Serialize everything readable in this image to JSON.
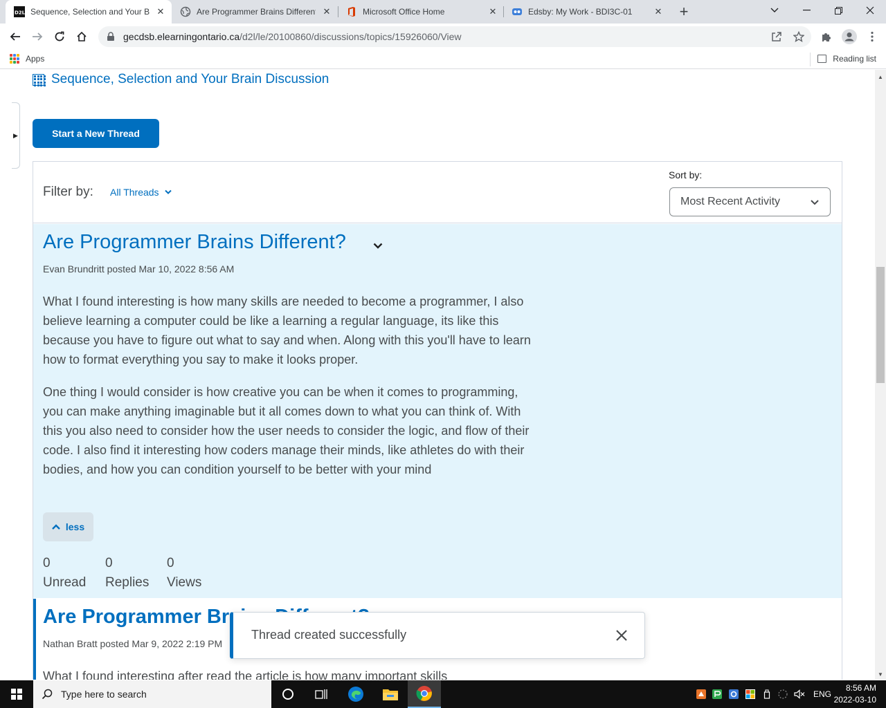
{
  "browser": {
    "tabs": [
      {
        "title": "Sequence, Selection and Your Bra",
        "active": true,
        "favicon": "d2l-logo-icon"
      },
      {
        "title": "Are Programmer Brains Different",
        "active": false,
        "favicon": "globe-icon"
      },
      {
        "title": "Microsoft Office Home",
        "active": false,
        "favicon": "office-icon"
      },
      {
        "title": "Edsby: My Work - BDI3C-01",
        "active": false,
        "favicon": "edsby-icon"
      }
    ],
    "url_host": "gecdsb.elearningontario.ca",
    "url_path": "/d2l/le/20100860/discussions/topics/15926060/View",
    "bookmarks": {
      "apps": "Apps",
      "reading_list": "Reading list"
    }
  },
  "page": {
    "breadcrumb": "Sequence, Selection and Your Brain Discussion",
    "new_thread_button": "Start a New Thread",
    "filter_label": "Filter by:",
    "filter_value": "All Threads",
    "sort_label": "Sort by:",
    "sort_value": "Most Recent Activity",
    "threads": [
      {
        "title": "Are Programmer Brains Different?",
        "author": "Evan Brundritt",
        "meta": "Evan Brundritt posted Mar 10, 2022 8:56 AM",
        "paragraphs": [
          "What I found interesting is how many skills are needed to become a programmer, I also believe learning a computer could be like a learning a regular language, its like this because you have to figure out what to say and when. Along with this you'll have to learn how to format everything you say to make it looks proper.",
          "One thing I would consider is how creative you can be when it comes to programming, you can make anything imaginable but it all comes down to what you can think of. With this you also need to consider how the user needs to consider the logic, and flow of their code. I also find it interesting how coders manage their minds, like athletes do with their bodies, and how you can condition yourself to be better with your mind"
        ],
        "less_label": "less",
        "stats": [
          {
            "count": "0",
            "label": "Unread"
          },
          {
            "count": "0",
            "label": "Replies"
          },
          {
            "count": "0",
            "label": "Views"
          }
        ]
      },
      {
        "title": "Are Programmer Brains Different?",
        "meta": "Nathan Bratt posted Mar 9, 2022 2:19 PM",
        "body_start": "What I found interesting after read the article is how many important skills"
      }
    ],
    "toast": "Thread created successfully"
  },
  "taskbar": {
    "search_placeholder": "Type here to search",
    "language": "ENG",
    "time": "8:56 AM",
    "date": "2022-03-10"
  },
  "colors": {
    "accent": "#006fbf",
    "selected_thread_bg": "#e3f4fc",
    "text": "#494c4e"
  }
}
